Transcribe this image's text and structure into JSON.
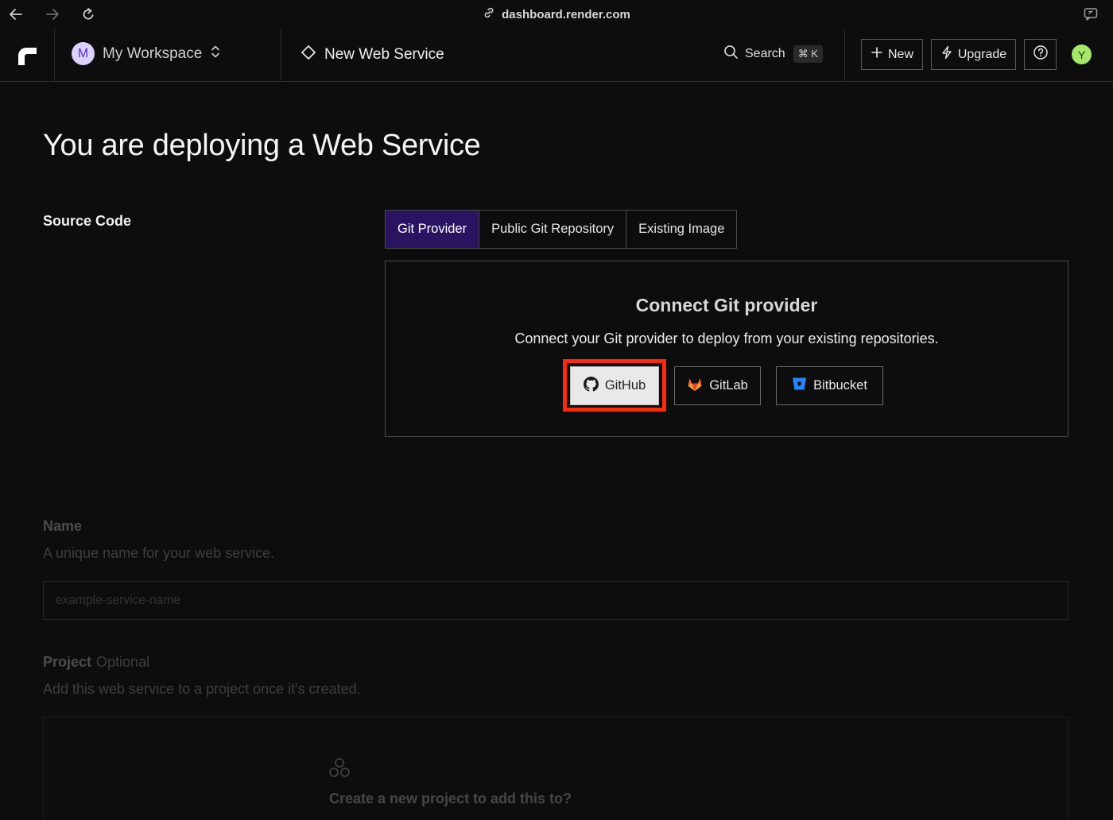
{
  "browser": {
    "url": "dashboard.render.com"
  },
  "header": {
    "workspace_initial": "M",
    "workspace_name": "My Workspace",
    "breadcrumb": "New Web Service",
    "search_label": "Search",
    "search_shortcut": "⌘ K",
    "new_label": "New",
    "upgrade_label": "Upgrade",
    "user_initial": "Y"
  },
  "page": {
    "title": "You are deploying a Web Service",
    "source_code_label": "Source Code"
  },
  "tabs": [
    {
      "label": "Git Provider",
      "active": true
    },
    {
      "label": "Public Git Repository",
      "active": false
    },
    {
      "label": "Existing Image",
      "active": false
    }
  ],
  "connect": {
    "title": "Connect Git provider",
    "description": "Connect your Git provider to deploy from your existing repositories.",
    "providers": [
      {
        "label": "GitHub",
        "icon": "github-icon"
      },
      {
        "label": "GitLab",
        "icon": "gitlab-icon"
      },
      {
        "label": "Bitbucket",
        "icon": "bitbucket-icon"
      }
    ]
  },
  "form": {
    "name_label": "Name",
    "name_help": "A unique name for your web service.",
    "name_placeholder": "example-service-name",
    "project_label": "Project",
    "project_optional": "Optional",
    "project_help": "Add this web service to a project once it's created.",
    "project_cta": "Create a new project to add this to?"
  },
  "colors": {
    "accent_tab": "#2a1360",
    "highlight": "#ff2a0a",
    "user_avatar": "#a6e96a"
  }
}
